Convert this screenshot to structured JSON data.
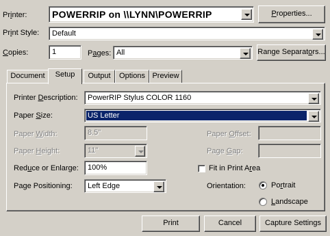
{
  "printer": {
    "label_pre": "Pr",
    "label_key": "i",
    "label_post": "nter:",
    "value": "POWERRIP on \\\\LYNN\\POWERRIP",
    "properties_key": "P",
    "properties_rest": "roperties..."
  },
  "print_style": {
    "label_pre": "Pr",
    "label_key": "i",
    "label_post": "nt Style:",
    "value": "Default"
  },
  "copies": {
    "label_key": "C",
    "label_post": "opies:",
    "value": "1"
  },
  "pages": {
    "label_pre": "P",
    "label_key": "a",
    "label_post": "ges:",
    "value": "All"
  },
  "range_separators": {
    "label_pre": "Range Separat",
    "label_key": "o",
    "label_post": "rs..."
  },
  "tabs": [
    {
      "label": "Document"
    },
    {
      "label": "Setup",
      "active": true
    },
    {
      "label": "Output"
    },
    {
      "label": "Options"
    },
    {
      "label": "Preview"
    }
  ],
  "setup": {
    "printer_description": {
      "label_pre": "Printer ",
      "label_key": "D",
      "label_post": "escription:",
      "value": "PowerRIP Stylus COLOR 1160"
    },
    "paper_size": {
      "label_pre": "Paper ",
      "label_key": "S",
      "label_post": "ize:",
      "value": "US Letter"
    },
    "paper_width": {
      "label_pre": "Paper ",
      "label_key": "W",
      "label_post": "idth:",
      "value": "8.5\""
    },
    "paper_height": {
      "label_pre": "Paper ",
      "label_key": "H",
      "label_post": "eight:",
      "value": "11\""
    },
    "reduce_enlarge": {
      "label_pre": "Red",
      "label_key": "u",
      "label_post": "ce or Enlarge:",
      "value": "100%"
    },
    "page_positioning": {
      "label_pre": "Pa",
      "label_key": "g",
      "label_post": "e Positioning:",
      "value": "Left Edge"
    },
    "paper_offset": {
      "label_pre": "Paper ",
      "label_key": "O",
      "label_post": "ffset:"
    },
    "page_gap": {
      "label_pre": "Page ",
      "label_key": "G",
      "label_post": "ap:"
    },
    "fit_in_print_area": {
      "label_pre": "Fit in Print A",
      "label_key": "r",
      "label_post": "ea",
      "checked": false
    },
    "orientation": {
      "label": "Orientation:",
      "portrait_pre": "Po",
      "portrait_key": "r",
      "portrait_post": "trait",
      "landscape_key": "L",
      "landscape_post": "andscape",
      "selected": "Portrait"
    }
  },
  "buttons": {
    "print": "Print",
    "cancel": "Cancel",
    "capture_settings": "Capture Settings"
  },
  "colors": {
    "face": "#d4d0c8",
    "selection": "#0a246a"
  }
}
